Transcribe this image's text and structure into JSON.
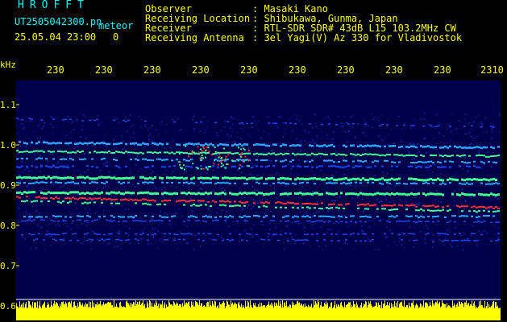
{
  "app_title": "HROFFT",
  "file_name": "UT2505042300.pn",
  "mode": "meteor",
  "datetime": "25.05.04 23:00",
  "counter": "0",
  "meta": [
    {
      "label": "Observer",
      "value": ": Masaki Kano"
    },
    {
      "label": "Receiving Location",
      "value": ": Shibukawa, Gunma, Japan"
    },
    {
      "label": "Receiver",
      "value": ": RTL-SDR SDR# 43dB L15 103.2MHz CW"
    },
    {
      "label": "Receiving Antenna",
      "value": ": 3el Yagi(V) Az 330 for Vladivostok"
    }
  ],
  "x_ticks": [
    "230",
    "230",
    "230",
    "230",
    "230",
    "230",
    "230",
    "230",
    "230",
    "2310"
  ],
  "y_unit": "kHz",
  "y_ticks": [
    "1.1",
    "1.0",
    "0.9",
    "0.8",
    "0.7",
    "0.6"
  ],
  "colors": {
    "cyan": "#00ffff",
    "yellow": "#ffff00",
    "plot_bg": "#00004a"
  }
}
